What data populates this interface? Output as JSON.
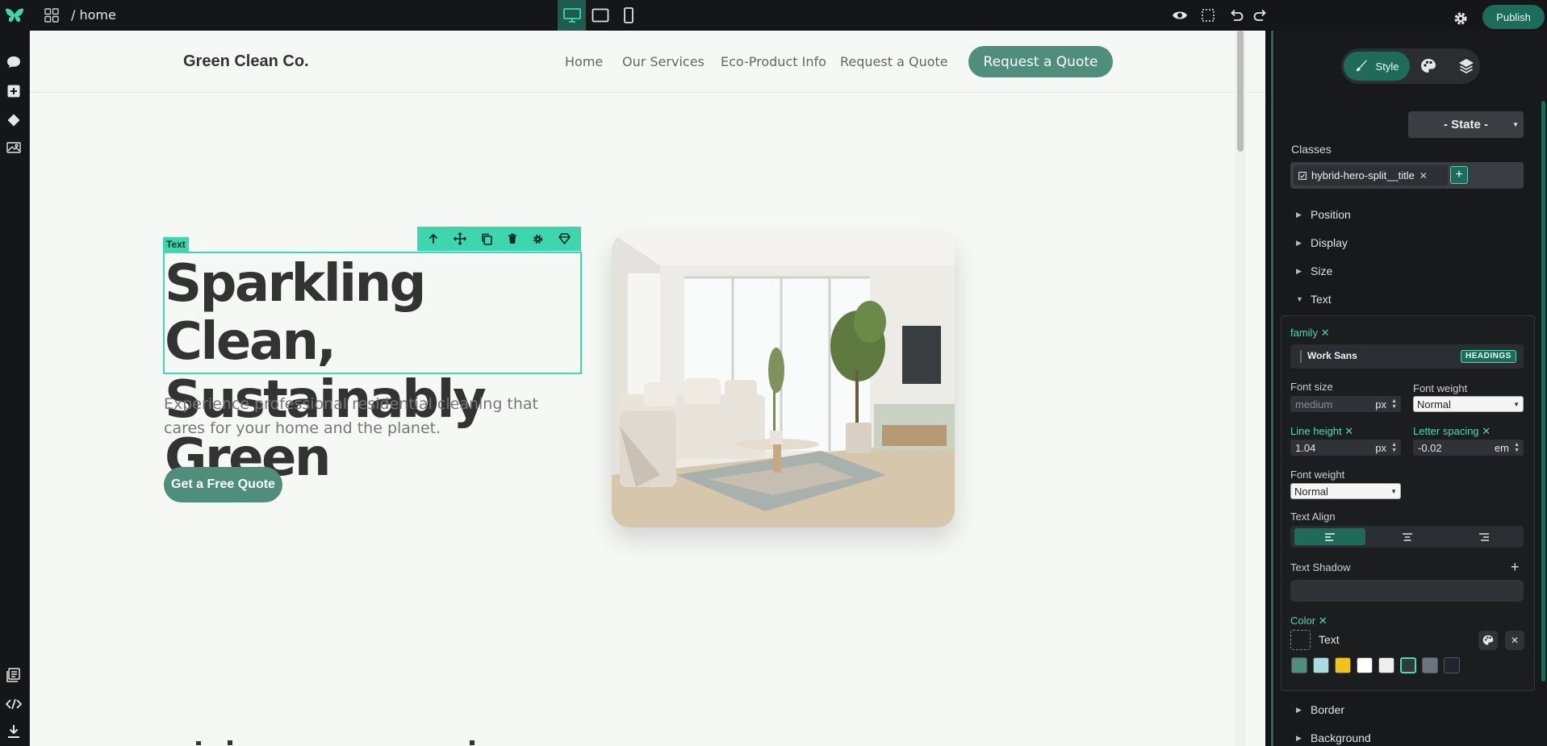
{
  "topbar": {
    "breadcrumb": "/ home",
    "publish_label": "Publish"
  },
  "site": {
    "brand": "Green Clean Co.",
    "nav": [
      "Home",
      "Our Services",
      "Eco-Product Info",
      "Request a Quote"
    ],
    "nav_cta": "Request a Quote",
    "hero": {
      "title_line1": "Sparkling Clean,",
      "title_line2": "Sustainably Green",
      "subtitle": "Experience professional residential cleaning that cares for your home and the planet.",
      "cta": "Get a Free Quote"
    }
  },
  "selection": {
    "tag": "Text"
  },
  "panel": {
    "mode_style": "Style",
    "state": "- State -",
    "classes_label": "Classes",
    "class_name": "hybrid-hero-split__title",
    "sections": [
      "Position",
      "Display",
      "Size",
      "Text"
    ],
    "sections_after": [
      "Border",
      "Background"
    ],
    "text": {
      "family_label": "family",
      "family_value": "Work Sans",
      "family_tag": "HEADINGS",
      "font_size_label": "Font size",
      "font_size_placeholder": "medium",
      "font_size_unit": "px",
      "font_weight_label": "Font weight",
      "font_weight_value": "Normal",
      "line_height_label": "Line height",
      "line_height_value": "1.04",
      "line_height_unit": "px",
      "letter_spacing_label": "Letter spacing",
      "letter_spacing_value": "-0.02",
      "letter_spacing_unit": "em",
      "font_weight2_label": "Font weight",
      "font_weight2_value": "Normal",
      "text_align_label": "Text Align",
      "text_shadow_label": "Text Shadow",
      "color_label": "Color",
      "color_value": "Text"
    },
    "palette": [
      "#4e8e7b",
      "#a9dbe0",
      "#f2c316",
      "#ffffff",
      "#eeeeee",
      "#2f3b38",
      "#6c7480",
      "#1f2430"
    ]
  },
  "colors": {
    "accent": "#3ed6ae",
    "brand_green": "#4e8e7b",
    "publish": "#1d6b5a"
  }
}
